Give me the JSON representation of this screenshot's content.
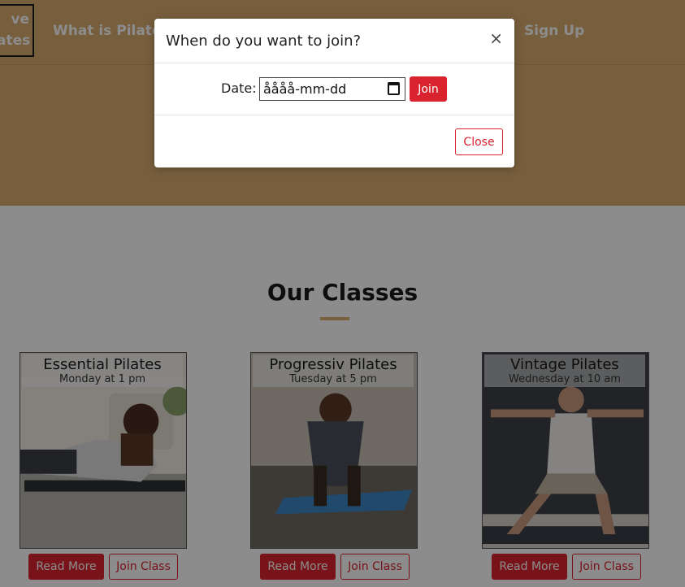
{
  "nav": {
    "logo_lines": [
      "ve",
      "ates"
    ],
    "what_is_pilates": "What is Pilates",
    "sign_up": "Sign Up"
  },
  "section": {
    "title": "Our Classes"
  },
  "classes": [
    {
      "name": "Essential Pilates",
      "time": "Monday at 1 pm",
      "read_more": "Read More",
      "join_class": "Join Class"
    },
    {
      "name": "Progressiv Pilates",
      "time": "Tuesday at 5 pm",
      "read_more": "Read More",
      "join_class": "Join Class"
    },
    {
      "name": "Vintage Pilates",
      "time": "Wednesday at 10 am",
      "read_more": "Read More",
      "join_class": "Join Class"
    }
  ],
  "modal": {
    "title": "When do you want to join?",
    "close_x": "×",
    "date_label": "Date:",
    "date_value": "åååå-mm-dd",
    "join_label": "Join",
    "close_label": "Close"
  },
  "colors": {
    "header_bg": "#d9ab6f",
    "accent_red": "#d9232e",
    "overlay": "rgba(0,0,0,0.45)"
  },
  "icons": {
    "calendar": "calendar-icon",
    "close": "close-icon"
  }
}
